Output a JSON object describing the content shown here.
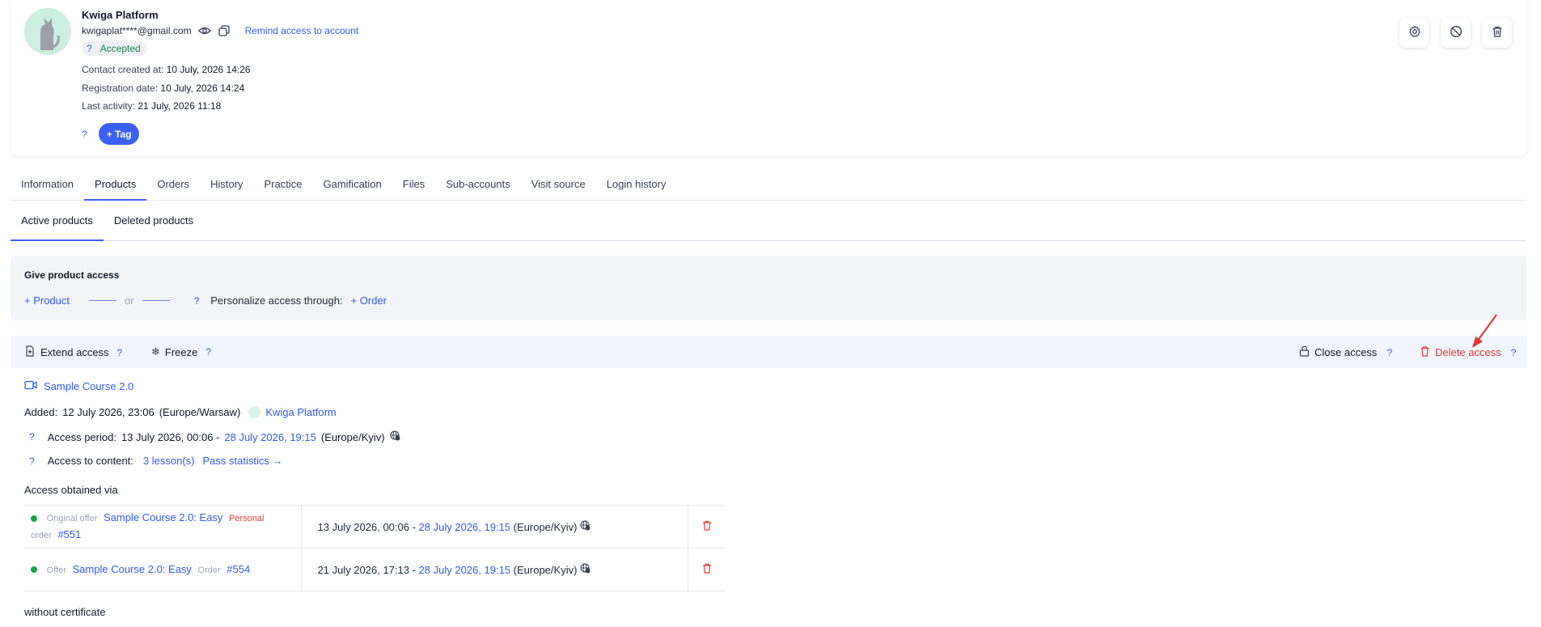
{
  "profile": {
    "name": "Kwiga Platform",
    "email": "kwigaplat****@gmail.com",
    "remind_link": "Remind access to account",
    "status_help": "?",
    "status": "Accepted",
    "contact_created_label": "Contact created at:",
    "contact_created_value": "10 July, 2026 14:26",
    "registration_label": "Registration date:",
    "registration_value": "10 July, 2026 14:24",
    "last_activity_label": "Last activity:",
    "last_activity_value": "21 July, 2026 11:18",
    "tag_help": "?",
    "tag_button": "+ Tag"
  },
  "tabs": [
    "Information",
    "Products",
    "Orders",
    "History",
    "Practice",
    "Gamification",
    "Files",
    "Sub-accounts",
    "Visit source",
    "Login history"
  ],
  "subtabs": [
    "Active products",
    "Deleted products"
  ],
  "give_access": {
    "title": "Give product access",
    "product_link": "+ Product",
    "or": "or",
    "help": "?",
    "personalize_label": "Personalize access through:",
    "order_link": "+ Order"
  },
  "actions": {
    "extend": "Extend access",
    "freeze": "Freeze",
    "close": "Close access",
    "delete": "Delete access",
    "help": "?"
  },
  "product": {
    "title": "Sample Course 2.0",
    "added_label": "Added:",
    "added_value": "12 July 2026, 23:06",
    "added_tz": "(Europe/Warsaw)",
    "added_by": "Kwiga Platform",
    "help": "?",
    "access_period_label": "Access period:",
    "access_start": "13 July 2026, 00:06 -",
    "access_end": "28 July 2026, 19:15",
    "access_tz": "(Europe/Kyiv)",
    "content_label": "Access to content:",
    "lessons_link": "3 lesson(s)",
    "stats_link": "Pass statistics →",
    "via_title": "Access obtained via",
    "certificate": "without certificate"
  },
  "via_rows": [
    {
      "type_label": "Original offer",
      "offer": "Sample Course 2.0: Easy",
      "tag": "Personal",
      "order_label": "order",
      "order_num": "#551",
      "start": "13 July 2026, 00:06 -",
      "end": "28 July 2026, 19:15",
      "tz": "(Europe/Kyiv)"
    },
    {
      "type_label": "Offer",
      "offer": "Sample Course 2.0: Easy",
      "order_label": "Order",
      "order_num": "#554",
      "start": "21 July 2026, 17:13 -",
      "end": "28 July 2026, 19:15",
      "tz": "(Europe/Kyiv)"
    }
  ],
  "colors": {
    "accent": "#3b5ff0",
    "danger": "#e53935",
    "success": "#16a34a"
  }
}
